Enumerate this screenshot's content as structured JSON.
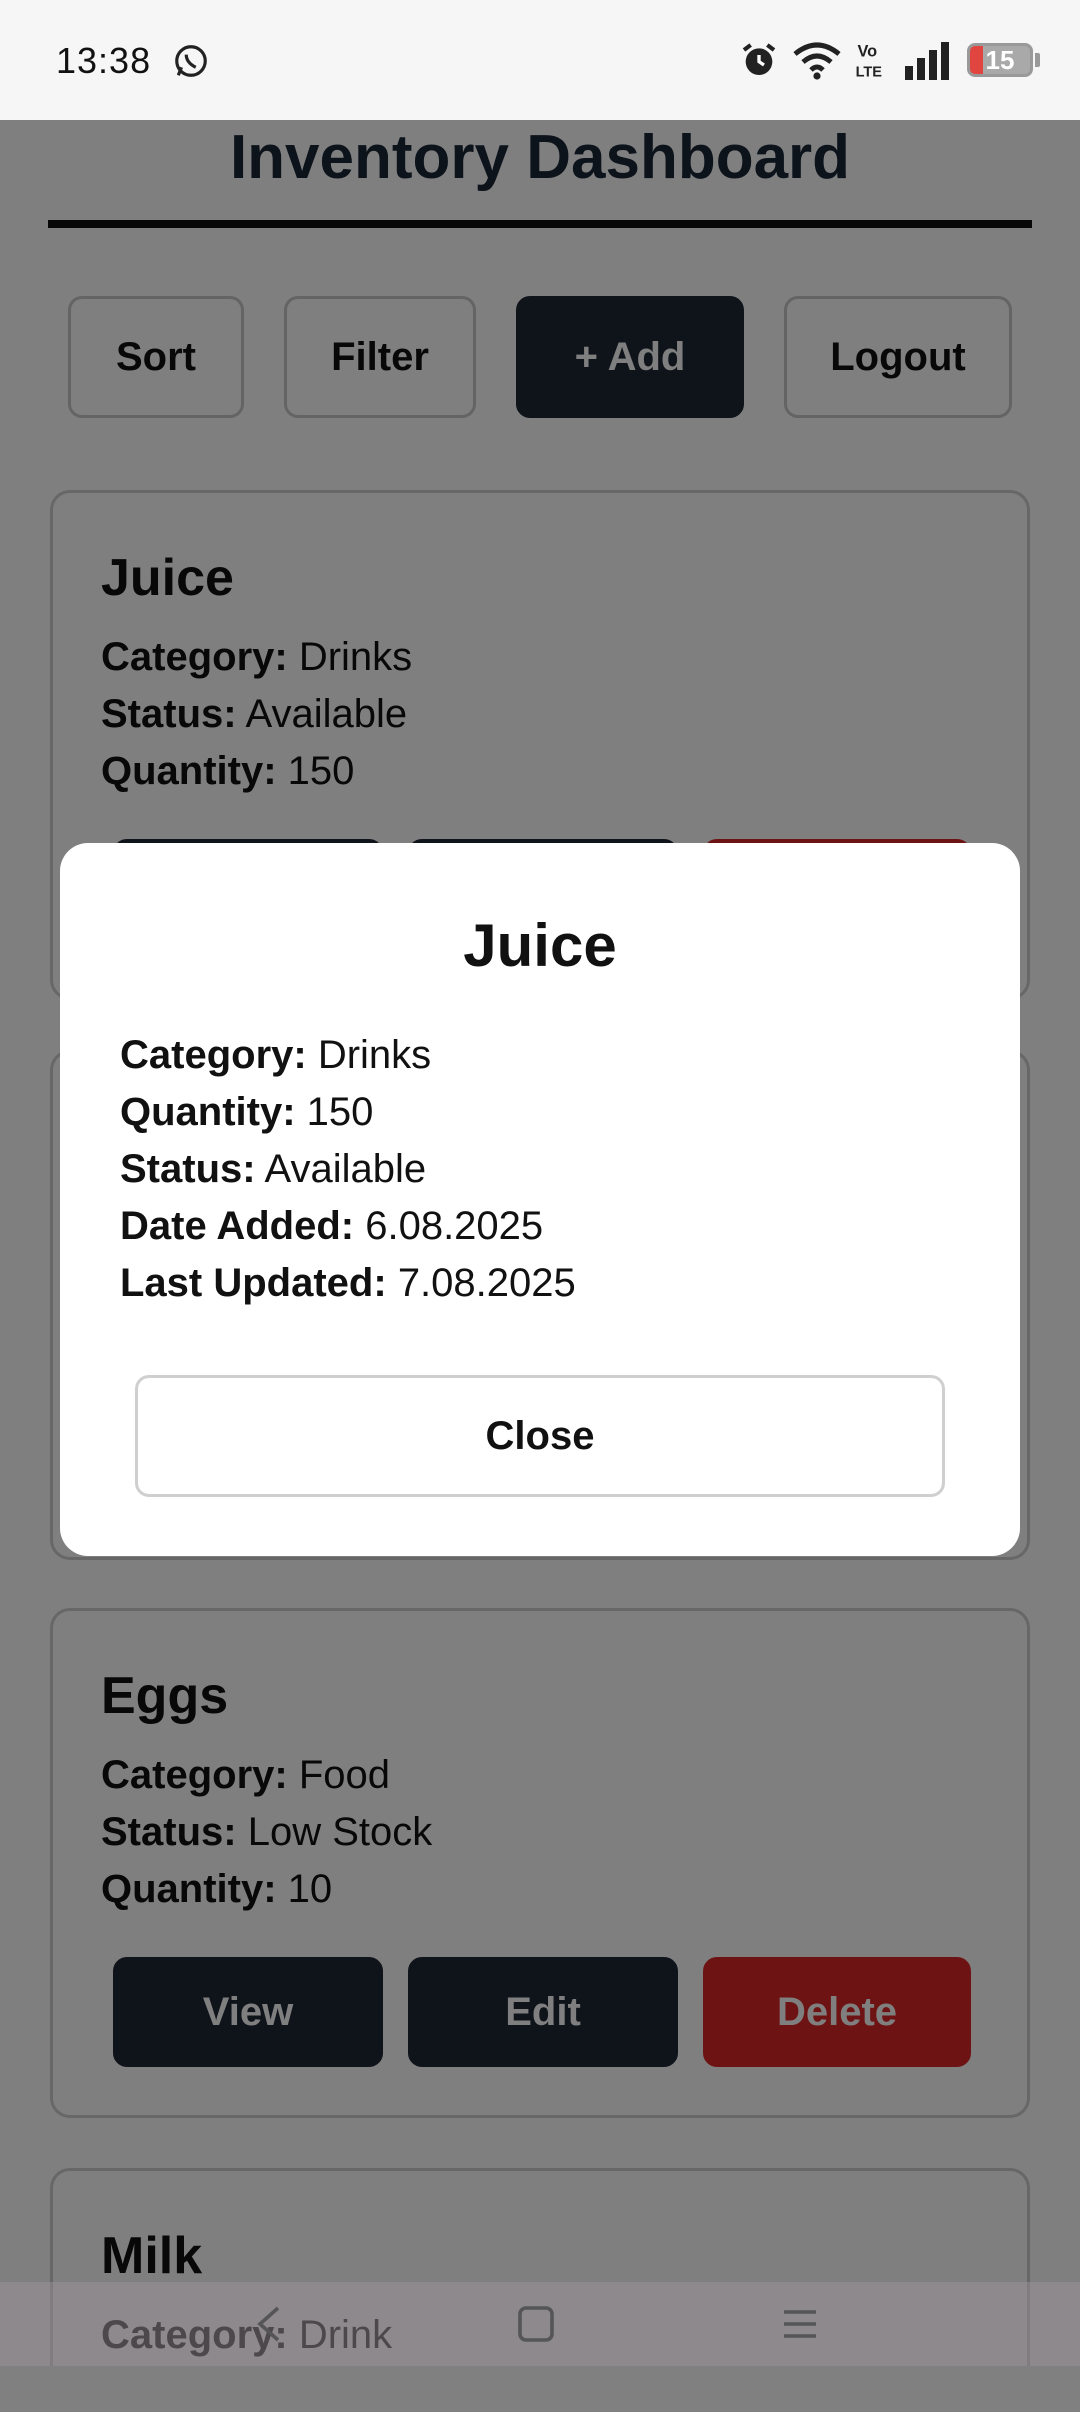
{
  "status_bar": {
    "time": "13:38",
    "battery": "15",
    "icons": [
      "whatsapp-icon",
      "alarm-icon",
      "wifi-icon",
      "volte-icon",
      "signal-icon",
      "battery-icon"
    ]
  },
  "header": {
    "title": "Inventory Dashboard"
  },
  "toolbar": {
    "sort": "Sort",
    "filter": "Filter",
    "add": "+ Add",
    "logout": "Logout"
  },
  "labels": {
    "category": "Category:",
    "status": "Status:",
    "quantity": "Quantity:",
    "date_added": "Date Added:",
    "last_updated": "Last Updated:",
    "view": "View",
    "edit": "Edit",
    "delete": "Delete"
  },
  "items": [
    {
      "name": "Juice",
      "category": "Drinks",
      "status": "Available",
      "quantity": "150"
    },
    {
      "name": "Eggs",
      "category": "Food",
      "status": "Low Stock",
      "quantity": "10"
    },
    {
      "name": "Milk",
      "category": "Drink"
    }
  ],
  "modal": {
    "title": "Juice",
    "category": "Drinks",
    "quantity": "150",
    "status": "Available",
    "date_added": "6.08.2025",
    "last_updated": "7.08.2025",
    "close": "Close"
  },
  "colors": {
    "primary": "#1f2937",
    "danger": "#dc2626",
    "title": "#1b2637"
  },
  "nav": {
    "icons": [
      "back-icon",
      "home-icon",
      "menu-icon"
    ]
  }
}
